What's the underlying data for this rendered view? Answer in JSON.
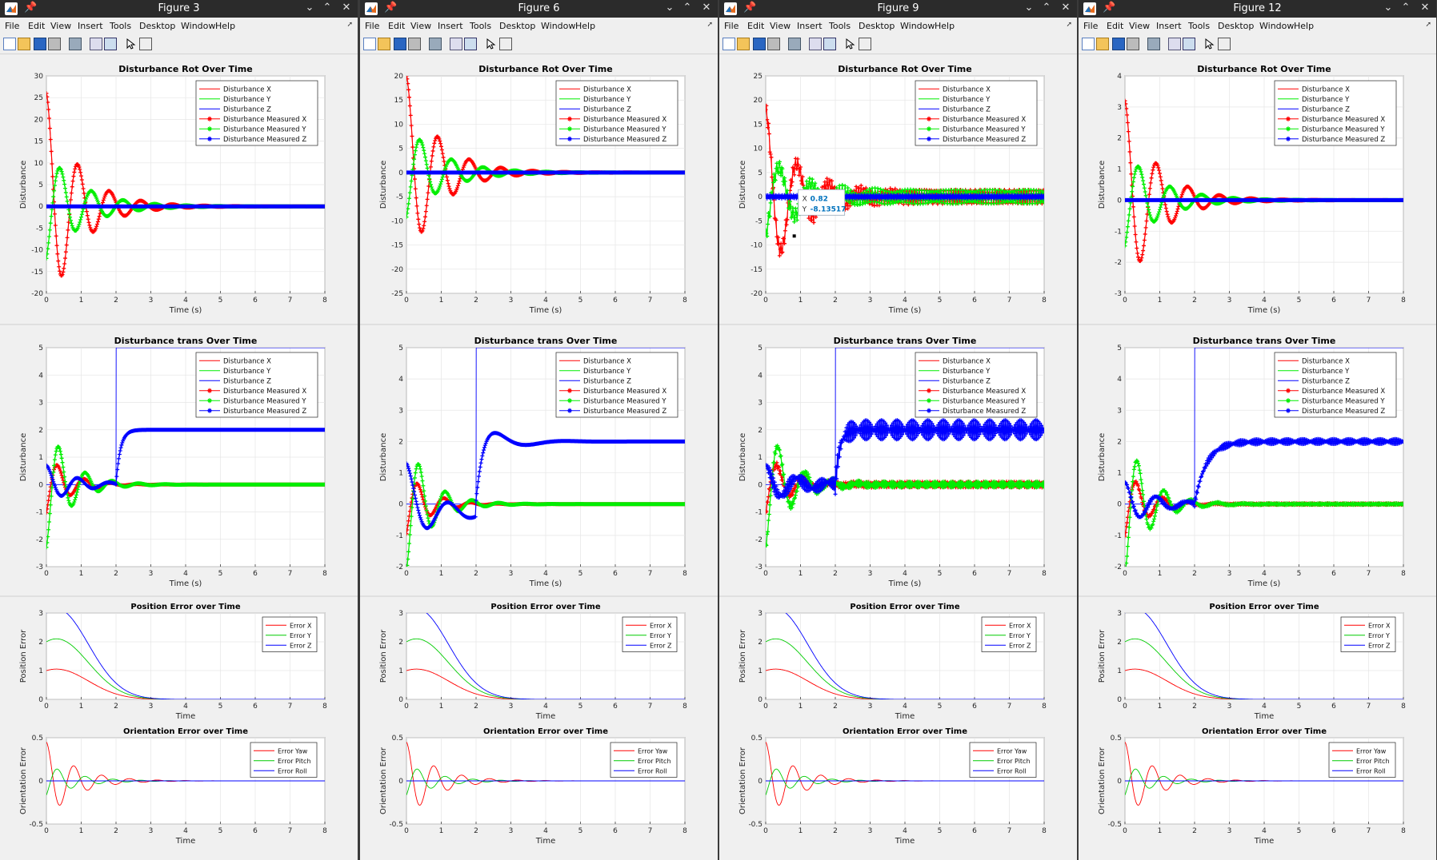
{
  "menu": [
    "File",
    "Edit",
    "View",
    "Insert",
    "Tools",
    "Desktop",
    "Window",
    "Help"
  ],
  "colors": {
    "x": "#ff0000",
    "y": "#00ee00",
    "z": "#0000ff",
    "err_x": "#ff0000",
    "err_y": "#00cc00",
    "err_z": "#0000ff"
  },
  "figures": [
    {
      "title": "Figure 3",
      "rot_ylim": [
        -20,
        30
      ],
      "rot_yticks": [
        -20,
        -15,
        -10,
        -5,
        0,
        5,
        10,
        15,
        20,
        25,
        30
      ],
      "trans_ylim": [
        -3,
        5
      ],
      "trans_yticks": [
        -3,
        -2,
        -1,
        0,
        1,
        2,
        3,
        4,
        5
      ],
      "rot_amp": 26,
      "trans_variant": 1
    },
    {
      "title": "Figure 6",
      "rot_ylim": [
        -25,
        20
      ],
      "rot_yticks": [
        -25,
        -20,
        -15,
        -10,
        -5,
        0,
        5,
        10,
        15,
        20
      ],
      "trans_ylim": [
        -2,
        5
      ],
      "trans_yticks": [
        -2,
        -1,
        0,
        1,
        2,
        3,
        4,
        5
      ],
      "rot_amp": 20,
      "trans_variant": 2
    },
    {
      "title": "Figure 9",
      "rot_ylim": [
        -20,
        25
      ],
      "rot_yticks": [
        -20,
        -15,
        -10,
        -5,
        0,
        5,
        10,
        15,
        20,
        25
      ],
      "trans_ylim": [
        -3,
        5
      ],
      "trans_yticks": [
        -3,
        -2,
        -1,
        0,
        1,
        2,
        3,
        4,
        5
      ],
      "rot_amp": 18,
      "trans_variant": 3,
      "datatip": {
        "x_label": "X",
        "x_value": "0.82",
        "y_label": "Y",
        "y_value": "-8.13517"
      }
    },
    {
      "title": "Figure 12",
      "rot_ylim": [
        -3,
        4
      ],
      "rot_yticks": [
        -3,
        -2,
        -1,
        0,
        1,
        2,
        3,
        4
      ],
      "trans_ylim": [
        -2,
        5
      ],
      "trans_yticks": [
        -2,
        -1,
        0,
        1,
        2,
        3,
        4,
        5
      ],
      "rot_amp": 3.2,
      "trans_variant": 4
    }
  ],
  "axes_text": {
    "rot_title": "Disturbance Rot Over Time",
    "trans_title": "Disturbance trans Over Time",
    "dist_ylabel": "Disturbance",
    "dist_xlabel": "Time (s)",
    "pos_title": "Position Error over Time",
    "pos_ylabel": "Position Error",
    "ori_title": "Orientation Error over Time",
    "ori_ylabel": "Orientation Error",
    "err_xlabel": "Time",
    "xticks": [
      0,
      1,
      2,
      3,
      4,
      5,
      6,
      7,
      8
    ],
    "pos_yticks": [
      0,
      1,
      2,
      3
    ],
    "ori_yticks": [
      "-0.5",
      "0",
      "0.5"
    ]
  },
  "legend_dist": [
    "Disturbance X",
    "Disturbance Y",
    "Disturbance Z",
    "Disturbance Measured X",
    "Disturbance Measured Y",
    "Disturbance Measured Z"
  ],
  "legend_pos": [
    "Error X",
    "Error Y",
    "Error Z"
  ],
  "legend_ori": [
    "Error Yaw",
    "Error Pitch",
    "Error Roll"
  ]
}
